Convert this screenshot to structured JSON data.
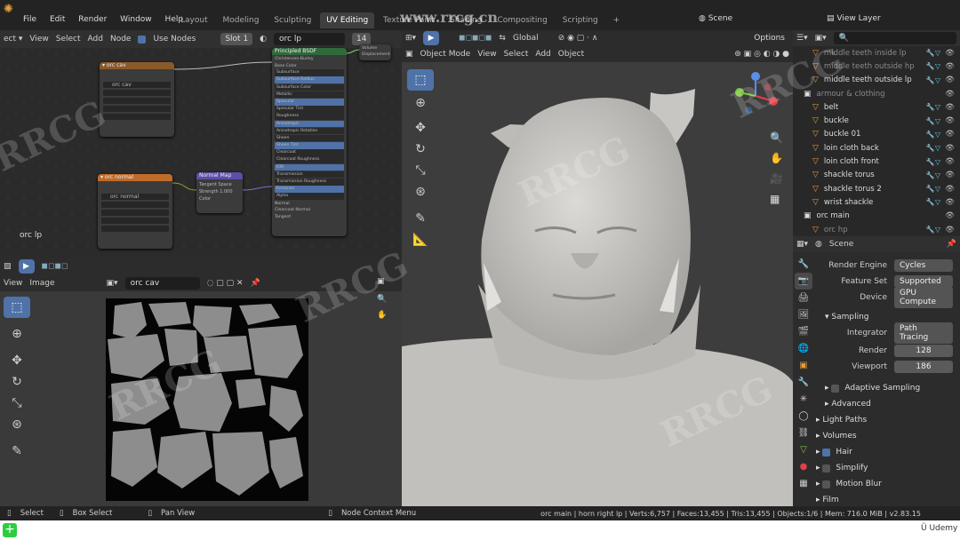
{
  "menu": [
    "File",
    "Edit",
    "Render",
    "Window",
    "Help"
  ],
  "workspaces": [
    "Layout",
    "Modeling",
    "Sculpting",
    "UV Editing",
    "Texture Paint",
    "Shading",
    "Animation",
    "Rendering",
    "Compositing",
    "Scripting"
  ],
  "active_workspace": "UV Editing",
  "scene_name": "Scene",
  "view_layer": "View Layer",
  "watermark_url": "www.rrcg.cn",
  "node_editor": {
    "header": [
      "View",
      "Select",
      "Add",
      "Node"
    ],
    "use_nodes": "Use Nodes",
    "slot": "Slot 1",
    "material": "orc lp",
    "users": "14",
    "label": "orc lp",
    "bsdf_title": "Principled BSDF",
    "bsdf_rows": [
      "Christensen-Burley",
      "Base Color",
      "Subsurface",
      "Subsurface Radius",
      "Subsurface Color",
      "Metallic",
      "Specular",
      "Specular Tint",
      "Roughness",
      "Anisotropic",
      "Anisotropic Rotation",
      "Sheen",
      "Sheen Tint",
      "Clearcoat",
      "Clearcoat Roughness",
      "IOR",
      "Transmission",
      "Transmission Roughness",
      "Emission",
      "Alpha",
      "Normal",
      "Clearcoat Normal",
      "Tangent"
    ],
    "output_rows": [
      "Volume",
      "Displacement"
    ],
    "tex_node_a": "orc cav",
    "tex_node_b": "orc normal",
    "normal_map_title": "Normal Map",
    "normal_map_rows": [
      "Tangent Space",
      "Strength 1.000",
      "Color"
    ]
  },
  "uv_editor": {
    "header": [
      "View",
      "Image"
    ],
    "image": "orc cav"
  },
  "viewport": {
    "mode": "Object Mode",
    "header": [
      "View",
      "Select",
      "Add",
      "Object"
    ],
    "transform": "Global",
    "options": "Options"
  },
  "outliner": {
    "search_placeholder": "",
    "items": [
      {
        "name": "middle teeth inside lp",
        "dim": true
      },
      {
        "name": "middle teeth outside hp",
        "dim": true
      },
      {
        "name": "middle teeth outside lp",
        "dim": false
      },
      {
        "name": "armour & clothing",
        "dim": true,
        "collection": true
      },
      {
        "name": "belt",
        "dim": false
      },
      {
        "name": "buckle",
        "dim": false
      },
      {
        "name": "buckle 01",
        "dim": false
      },
      {
        "name": "loin cloth back",
        "dim": false
      },
      {
        "name": "loin cloth front",
        "dim": false
      },
      {
        "name": "shackle torus",
        "dim": false
      },
      {
        "name": "shackle torus 2",
        "dim": false
      },
      {
        "name": "wrist shackle",
        "dim": false
      },
      {
        "name": "orc main",
        "dim": false,
        "collection": true
      },
      {
        "name": "orc hp",
        "dim": true
      }
    ]
  },
  "properties": {
    "scene": "Scene",
    "render_engine_label": "Render Engine",
    "render_engine": "Cycles",
    "feature_set_label": "Feature Set",
    "feature_set": "Supported",
    "device_label": "Device",
    "device": "GPU Compute",
    "sampling": "Sampling",
    "integrator_label": "Integrator",
    "integrator": "Path Tracing",
    "render_label": "Render",
    "render_samples": "128",
    "viewport_label": "Viewport",
    "viewport_samples": "186",
    "adaptive": "Adaptive Sampling",
    "advanced": "Advanced",
    "light_paths": "Light Paths",
    "volumes": "Volumes",
    "hair": "Hair",
    "simplify": "Simplify",
    "motion_blur": "Motion Blur",
    "film": "Film"
  },
  "status": {
    "select": "Select",
    "box_select": "Box Select",
    "pan_view": "Pan View",
    "node_context": "Node Context Menu",
    "stats": "orc main | horn right lp | Verts:6,757 | Faces:13,455 | Tris:13,455 | Objects:1/6 | Mem: 716.0 MiB | v2.83.15",
    "udemy": "Udemy"
  },
  "colors": {
    "accent": "#4f72a8",
    "cone": "#e59a3b",
    "modifier": "#5fc8e0",
    "mesh": "#cfcdca"
  }
}
